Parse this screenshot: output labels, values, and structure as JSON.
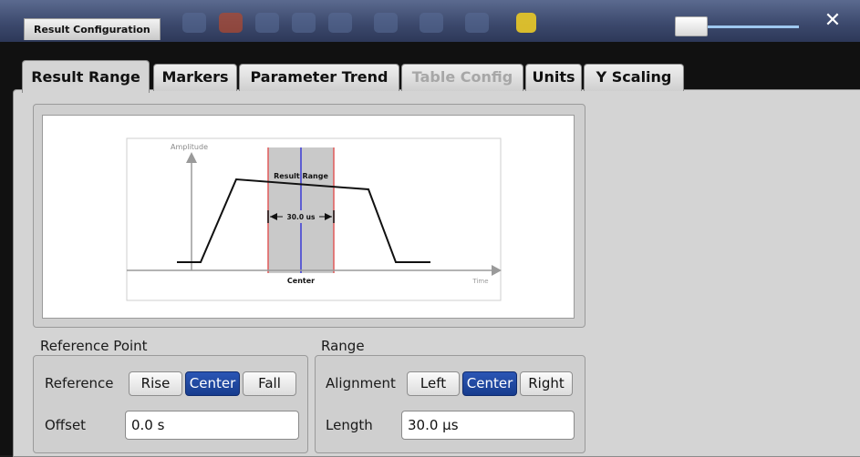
{
  "window": {
    "title": "Result Configuration",
    "close_symbol": "✕"
  },
  "tabs": [
    {
      "label": "Result Range",
      "active": true
    },
    {
      "label": "Markers"
    },
    {
      "label": "Parameter Trend"
    },
    {
      "label": "Table Config",
      "disabled": true
    },
    {
      "label": "Units"
    },
    {
      "label": "Y Scaling"
    }
  ],
  "diagram": {
    "amplitude_label": "Amplitude",
    "result_range_label": "Result Range",
    "width_label": "30.0 us",
    "center_label": "Center",
    "time_label": "Time"
  },
  "reference_point": {
    "group_title": "Reference Point",
    "reference_label": "Reference",
    "options": [
      "Rise",
      "Center",
      "Fall"
    ],
    "selected": "Center",
    "offset_label": "Offset",
    "offset_value": "0.0 s"
  },
  "range": {
    "group_title": "Range",
    "alignment_label": "Alignment",
    "options": [
      "Left",
      "Center",
      "Right"
    ],
    "selected": "Center",
    "length_label": "Length",
    "length_value": "30.0 µs"
  },
  "colors": {
    "selected_button": "#1f4aa5",
    "result_range_shade": "#c9c9c9",
    "range_border": "#e05a5a",
    "center_line": "#3b3bd6"
  }
}
